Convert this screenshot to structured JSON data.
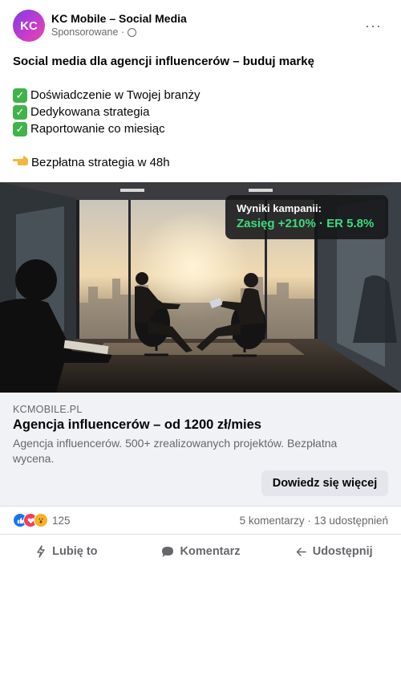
{
  "header": {
    "avatar_initials": "KC",
    "page_name": "KC Mobile – Social Media",
    "sponsored": "Sponsorowane ·",
    "more_label": "···"
  },
  "post": {
    "headline": "Social media dla agencji influencerów – buduj markę",
    "checks": [
      "Doświadczenie w Twojej branży",
      "Dedykowana strategia",
      "Raportowanie co miesiąc"
    ],
    "check_glyph": "✓",
    "cta": "Bezpłatna strategia w 48h",
    "cta_icon": "pointing-hand-icon"
  },
  "image_overlay": {
    "title": "Wyniki kampanii:",
    "metrics": "Zasięg +210% · ER 5.8%"
  },
  "link_preview": {
    "domain": "KCMOBILE.PL",
    "title": "Agencja influencerów – od 1200 zł/mies",
    "description": "Agencja influencerów. 500+ zrealizowanych projektów. Bezpłatna wycena.",
    "button_label": "Dowiedz się więcej"
  },
  "reactions": {
    "count": "125",
    "comments_shares": "5 komentarzy · 13 udostępnień",
    "icons": [
      "like-icon",
      "love-icon",
      "wow-icon"
    ]
  },
  "actions": {
    "like": "Lubię to",
    "comment": "Komentarz",
    "share": "Udostępnij"
  },
  "colors": {
    "accent_green": "#3ddc7d",
    "check_green": "#41b34a",
    "muted_text": "#65676b",
    "link_box_bg": "#f0f2f5"
  }
}
